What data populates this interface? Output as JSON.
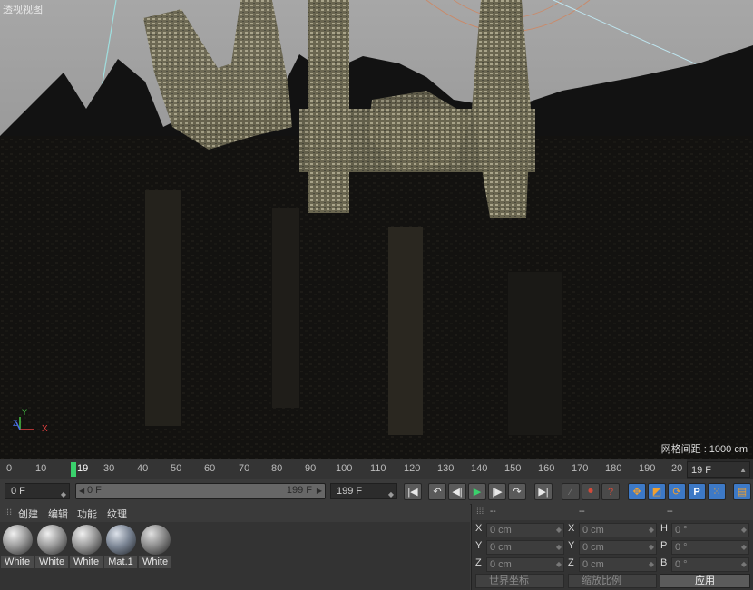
{
  "viewport": {
    "label": "透视视图",
    "grid_spacing": "网格间距 : 1000 cm",
    "axes": {
      "x": "X",
      "y": "Y",
      "z": "Z"
    }
  },
  "timeline": {
    "ticks": [
      "0",
      "10",
      "19",
      "30",
      "40",
      "50",
      "60",
      "70",
      "80",
      "90",
      "100",
      "110",
      "120",
      "130",
      "140",
      "150",
      "160",
      "170",
      "180",
      "190",
      "20"
    ],
    "current_frame": "19",
    "current_frame_field": "19 F"
  },
  "transport": {
    "start_field": "0 F",
    "range_start": "0 F",
    "range_end": "199 F",
    "end_field": "199 F"
  },
  "material_manager": {
    "menu": [
      "创建",
      "编辑",
      "功能",
      "纹理"
    ],
    "materials": [
      {
        "name": "White",
        "tone": "#b9b9b9"
      },
      {
        "name": "White",
        "tone": "#b9b9b9"
      },
      {
        "name": "White",
        "tone": "#b9b9b9"
      },
      {
        "name": "Mat.1",
        "tone": "#8f97a3"
      },
      {
        "name": "White",
        "tone": "#a8a8a8"
      }
    ]
  },
  "coordinates": {
    "headers": [
      "--",
      "--",
      "--"
    ],
    "rows": [
      {
        "a_label": "X",
        "a_value": "0 cm",
        "b_label": "X",
        "b_value": "0 cm",
        "c_label": "H",
        "c_value": "0 °"
      },
      {
        "a_label": "Y",
        "a_value": "0 cm",
        "b_label": "Y",
        "b_value": "0 cm",
        "c_label": "P",
        "c_value": "0 °"
      },
      {
        "a_label": "Z",
        "a_value": "0 cm",
        "b_label": "Z",
        "b_value": "0 cm",
        "c_label": "B",
        "c_value": "0 °"
      }
    ],
    "coord_system": "世界坐标",
    "scale_mode": "缩放比例",
    "apply": "应用"
  },
  "colors": {
    "accent": "#3d79c6",
    "playhead": "#3ad16c",
    "record": "#d24a3a"
  }
}
